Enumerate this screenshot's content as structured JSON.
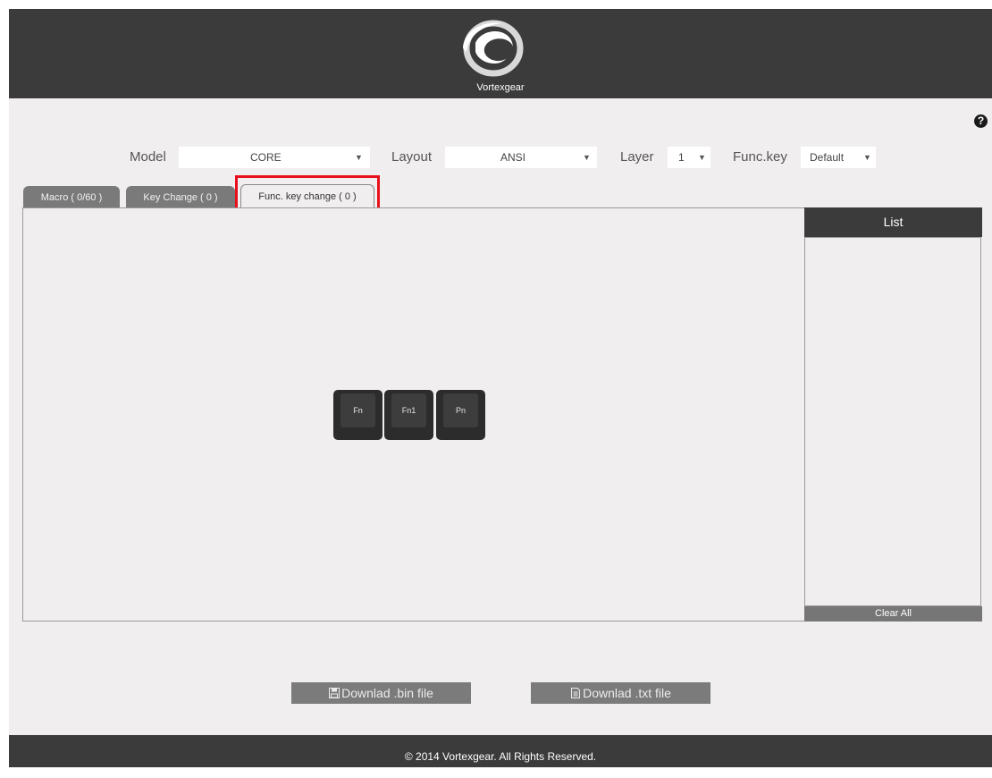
{
  "header": {
    "brand": "Vortexgear"
  },
  "help": {
    "icon": "help-icon",
    "glyph": "?"
  },
  "selectors": {
    "model": {
      "label": "Model",
      "value": "CORE"
    },
    "layout": {
      "label": "Layout",
      "value": "ANSI"
    },
    "layer": {
      "label": "Layer",
      "value": "1"
    },
    "funckey": {
      "label": "Func.key",
      "value": "Default"
    }
  },
  "tabs": [
    {
      "label": "Macro ( 0/60 )"
    },
    {
      "label": "Key Change ( 0 )"
    },
    {
      "label": "Func. key change ( 0 )"
    }
  ],
  "keys": [
    {
      "label": "Fn"
    },
    {
      "label": "Fn1"
    },
    {
      "label": "Pn"
    }
  ],
  "list": {
    "title": "List",
    "clear_label": "Clear All"
  },
  "downloads": {
    "bin_label": "Downlad .bin file",
    "txt_label": "Downlad .txt file"
  },
  "footer": {
    "text": "© 2014 Vortexgear. All Rights Reserved."
  },
  "colors": {
    "highlight": "#e8101c",
    "header": "#3b3b3b",
    "background": "#f1eeef"
  }
}
